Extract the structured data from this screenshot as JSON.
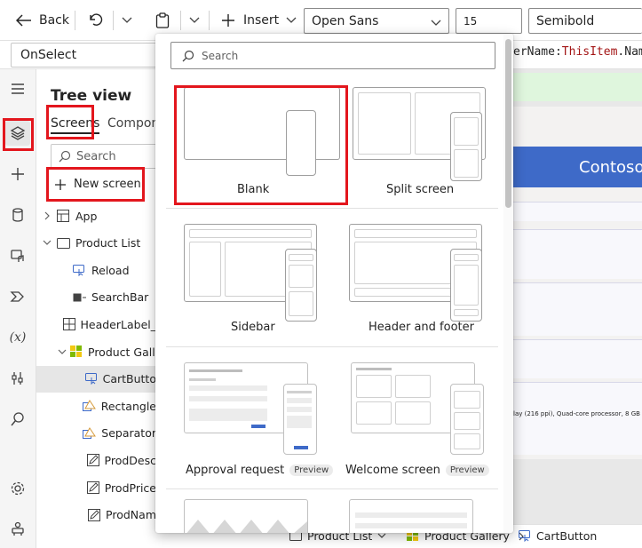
{
  "colors": {
    "accent": "#3e6ac8",
    "highlight": "#e3161d",
    "formula_keyword": "#a31515"
  },
  "toolbar": {
    "back_label": "Back",
    "insert_label": "Insert",
    "font_value": "Open Sans",
    "font_size_value": "15",
    "font_weight_value": "Semibold"
  },
  "formula_bar": {
    "property": "OnSelect",
    "formula_prefix": "erName:",
    "formula_keyword": "ThisItem",
    "formula_suffix": ".Name"
  },
  "rail": {
    "icons": [
      "tree-view-icon",
      "insert-icon",
      "data-icon",
      "media-icon",
      "power-automate-icon",
      "variables-icon",
      "advanced-tools-icon",
      "search-icon",
      "settings-icon",
      "virtual-agent-icon"
    ]
  },
  "tree": {
    "title": "Tree view",
    "tabs": {
      "screens": "Screens",
      "components": "Components"
    },
    "search_placeholder": "Search",
    "new_screen_label": "New screen",
    "items": [
      {
        "label": "App",
        "icon": "app-icon",
        "level": 0,
        "caret": "right"
      },
      {
        "label": "Product List",
        "icon": "screen-icon",
        "level": 0,
        "caret": "down"
      },
      {
        "label": "Reload",
        "icon": "button-icon",
        "level": 1
      },
      {
        "label": "SearchBar",
        "icon": "textinput-icon",
        "level": 1
      },
      {
        "label": "HeaderLabel_",
        "icon": "label-icon",
        "level": 1
      },
      {
        "label": "Product Galle",
        "icon": "gallery-icon",
        "level": 1,
        "caret": "down"
      },
      {
        "label": "CartButto",
        "icon": "button-icon",
        "level": 2,
        "selected": true
      },
      {
        "label": "Rectangle",
        "icon": "shape-icon",
        "level": 2
      },
      {
        "label": "Separator",
        "icon": "shape-icon",
        "level": 2
      },
      {
        "label": "ProdDesc",
        "icon": "edit-icon",
        "level": 2
      },
      {
        "label": "ProdPrice",
        "icon": "edit-icon",
        "level": 2
      },
      {
        "label": "ProdNam",
        "icon": "edit-icon",
        "level": 2
      }
    ]
  },
  "canvas": {
    "banner_text": "Contoso",
    "spec_text": "lay (216 ppi), Quad-core processor, 8 GB ir"
  },
  "statusbar": {
    "crumbs": [
      "Product List",
      "Product Gallery",
      "CartButton"
    ]
  },
  "panel": {
    "search_placeholder": "Search",
    "templates": [
      {
        "label": "Blank",
        "badge": ""
      },
      {
        "label": "Split screen",
        "badge": ""
      },
      {
        "label": "Sidebar",
        "badge": ""
      },
      {
        "label": "Header and footer",
        "badge": ""
      },
      {
        "label": "Approval request",
        "badge": "Preview"
      },
      {
        "label": "Welcome screen",
        "badge": "Preview"
      }
    ]
  }
}
